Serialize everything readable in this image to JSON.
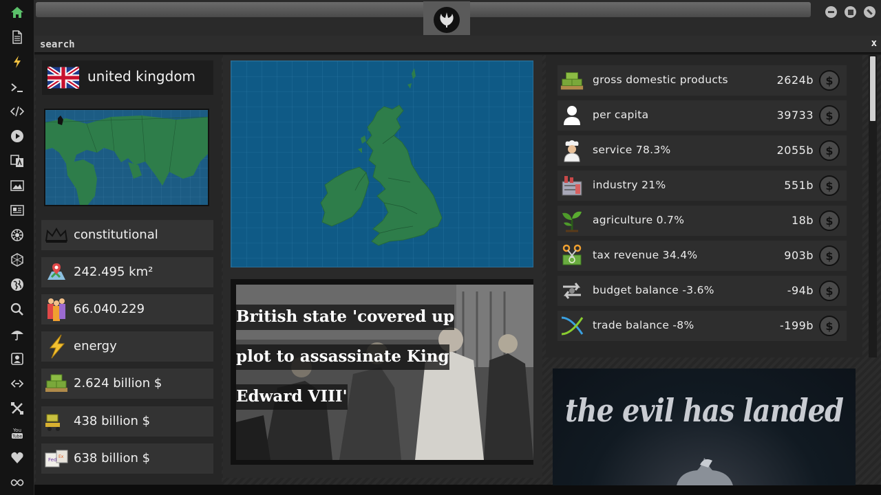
{
  "sidebar": {
    "icons": [
      "home-icon",
      "document-icon",
      "bolt-icon",
      "terminal-icon",
      "code-icon",
      "play-icon",
      "translate-icon",
      "image-icon",
      "news-icon",
      "settings-icon",
      "hexagon-icon",
      "globe-icon",
      "search-icon",
      "umbrella-icon",
      "contact-icon",
      "link-icon",
      "tools-icon",
      "youtube-icon",
      "heart-icon",
      "infinity-icon"
    ]
  },
  "titlebar": {
    "logo": "rebel-alliance-logo"
  },
  "search": {
    "placeholder": "search",
    "close_label": "x"
  },
  "country": {
    "name": "united kingdom",
    "stats": [
      {
        "icon": "crown-icon",
        "text": "constitutional"
      },
      {
        "icon": "map-pin-icon",
        "text": "242.495 km²"
      },
      {
        "icon": "population-icon",
        "text": "66.040.229"
      },
      {
        "icon": "energy-icon",
        "text": "energy"
      },
      {
        "icon": "money-stack-icon",
        "text": "2.624 billion $"
      },
      {
        "icon": "forklift-icon",
        "text": "438 billion $"
      },
      {
        "icon": "package-icon",
        "text": "638 billion $"
      }
    ]
  },
  "news": {
    "headline_lines": [
      "British state 'covered up",
      "plot to assassinate King",
      "Edward VIII'"
    ]
  },
  "economy": [
    {
      "icon": "money-pallet-icon",
      "label": "gross domestic products",
      "value": "2624b"
    },
    {
      "icon": "person-icon",
      "label": "per capita",
      "value": "39733"
    },
    {
      "icon": "chef-icon",
      "label": "service 78.3%",
      "value": "2055b"
    },
    {
      "icon": "factory-icon",
      "label": "industry 21%",
      "value": "551b"
    },
    {
      "icon": "plant-icon",
      "label": "agriculture 0.7%",
      "value": "18b"
    },
    {
      "icon": "tax-scissors-icon",
      "label": "tax revenue 34.4%",
      "value": "903b"
    },
    {
      "icon": "balance-arrows-icon",
      "label": "budget balance -3.6%",
      "value": "-94b"
    },
    {
      "icon": "trade-cross-icon",
      "label": "trade balance -8%",
      "value": "-199b"
    }
  ],
  "economy_button_symbol": "$",
  "promo": {
    "title": "the evil has landed"
  },
  "colors": {
    "ocean": "#0f5a86",
    "land": "#2e7d4a",
    "panel": "#333333"
  }
}
